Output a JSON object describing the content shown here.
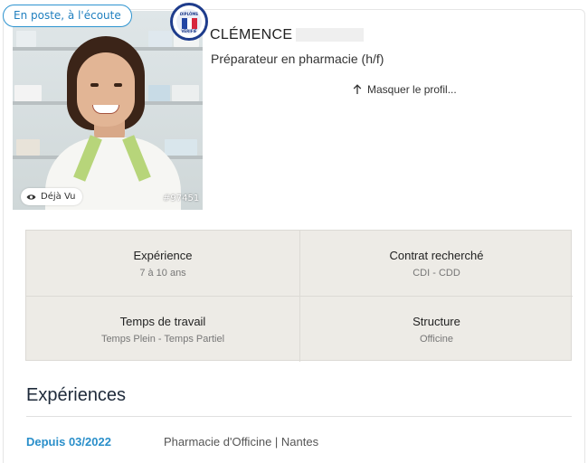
{
  "status_badge": "En poste, à l'écoute",
  "seal": {
    "top_text": "DIPLÔME",
    "bottom_text": "VÉRIFIÉ",
    "colors": [
      "#2346a3",
      "#ffffff",
      "#d7263d"
    ]
  },
  "photo": {
    "deja_vu_label": "Déjà Vu",
    "deja_vu_icon": "eye-icon",
    "reference": "#97451"
  },
  "candidate": {
    "first_name": "CLÉMENCE",
    "job_title": "Préparateur en pharmacie (h/f)",
    "hide_profile_label": "Masquer le profil...",
    "hide_profile_icon": "arrow-up-icon"
  },
  "info": [
    {
      "label": "Expérience",
      "value": "7 à 10 ans"
    },
    {
      "label": "Contrat recherché",
      "value": "CDI - CDD"
    },
    {
      "label": "Temps de travail",
      "value": "Temps Plein - Temps Partiel"
    },
    {
      "label": "Structure",
      "value": "Officine"
    }
  ],
  "experiences": {
    "title": "Expériences",
    "items": [
      {
        "date": "Depuis 03/2022",
        "place": "Pharmacie d'Officine | Nantes"
      }
    ]
  },
  "colors": {
    "accent": "#2a8fca",
    "badge_border": "#2e94d0",
    "grid_bg": "#edebe6"
  }
}
